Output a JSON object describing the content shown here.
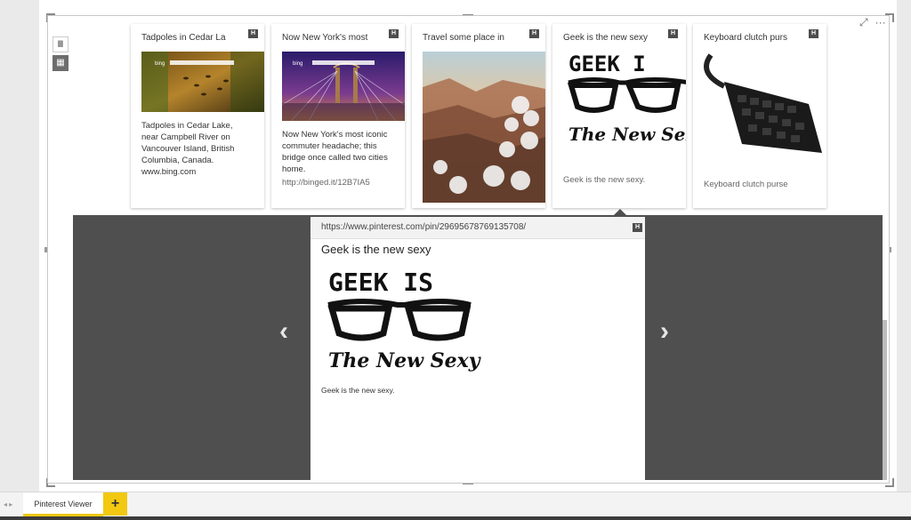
{
  "toolbar": {
    "focus_icon": "⤢",
    "more_icon": "···"
  },
  "view_toggle": {
    "list_icon": "Ⅲ",
    "grid_icon": "▦"
  },
  "pin_badge": "H",
  "cards": [
    {
      "title": "Tadpoles in Cedar La",
      "desc_lines": [
        "Tadpoles in Cedar Lake,",
        "near Campbell River on",
        "Vancouver Island, British",
        "Columbia, Canada.",
        "www.bing.com"
      ],
      "image_caption": "bing"
    },
    {
      "title": "Now New York's most",
      "desc_lines": [
        "Now New York's most iconic",
        "commuter headache; this",
        "bridge once called two cities",
        "home."
      ],
      "link": "http://binged.it/12B7IA5",
      "image_caption": "bing"
    },
    {
      "title": "Travel some place in"
    },
    {
      "title": "Geek is the new sexy",
      "subtitle": "Geek is the new sexy.",
      "image_top": "GEEK I",
      "image_bottom": "The New Sex"
    },
    {
      "title": "Keyboard clutch purs",
      "subtitle": "Keyboard clutch purse"
    }
  ],
  "detail": {
    "url": "https://www.pinterest.com/pin/29695678769135708/",
    "title": "Geek is the new sexy",
    "image_top": "GEEK  IS",
    "image_bottom": "The New Sexy",
    "description": "Geek is the new sexy."
  },
  "nav": {
    "prev": "‹",
    "next": "›"
  },
  "page_nav": {
    "first": "◂",
    "last": "▸"
  },
  "tabs": {
    "active": "Pinterest Viewer",
    "add": "+"
  }
}
